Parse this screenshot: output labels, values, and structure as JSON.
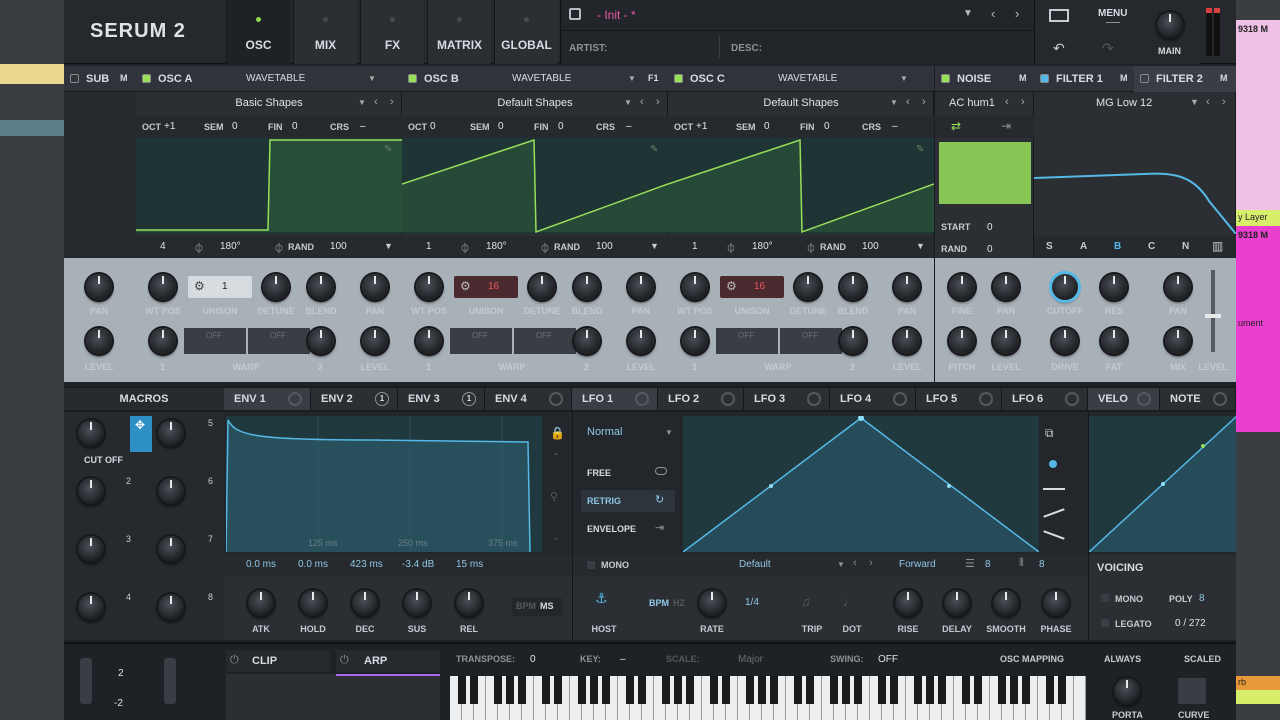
{
  "header": {
    "logo": "SERUM 2",
    "tabs": [
      "OSC",
      "MIX",
      "FX",
      "MATRIX",
      "GLOBAL"
    ],
    "preset_name": "- Init - *",
    "artist_label": "ARTIST:",
    "desc_label": "DESC:",
    "menu_label": "MENU",
    "main_label": "MAIN"
  },
  "host_right": {
    "top_code": "9318 M",
    "layer": "y Layer",
    "mid_code": "9318 M",
    "bottom": "ument",
    "rb": "rb"
  },
  "sub": {
    "label": "SUB",
    "m": "M"
  },
  "osc": [
    {
      "name": "OSC A",
      "type": "WAVETABLE",
      "table": "Basic Shapes",
      "oct": "+1",
      "sem": "0",
      "fin": "0",
      "crs": "–",
      "pos": "4",
      "phase": "180°",
      "rand_label": "RAND",
      "rand": "100",
      "unison": "1",
      "warp_l": "1",
      "warp_r": "2"
    },
    {
      "name": "OSC B",
      "type": "WAVETABLE",
      "table": "Default Shapes",
      "oct": "0",
      "sem": "0",
      "fin": "0",
      "crs": "–",
      "pos": "1",
      "phase": "180°",
      "rand_label": "RAND",
      "rand": "100",
      "unison": "16",
      "warp_l": "1",
      "warp_r": "2",
      "extra": "F1"
    },
    {
      "name": "OSC C",
      "type": "WAVETABLE",
      "table": "Default Shapes",
      "oct": "+1",
      "sem": "0",
      "fin": "0",
      "crs": "–",
      "pos": "1",
      "phase": "180°",
      "rand_label": "RAND",
      "rand": "100",
      "unison": "16",
      "warp_l": "1",
      "warp_r": "2"
    }
  ],
  "osc_labels": {
    "oct": "OCT",
    "sem": "SEM",
    "fin": "FIN",
    "crs": "CRS",
    "pan": "PAN",
    "level": "LEVEL",
    "wtpos": "WT POS",
    "unison": "UNISON",
    "detune": "DETUNE",
    "blend": "BLEND",
    "warp": "WARP",
    "off": "OFF"
  },
  "noise": {
    "label": "NOISE",
    "m": "M",
    "sample": "AC hum1",
    "start_label": "START",
    "start": "0",
    "rand_label": "RAND",
    "rand": "0",
    "fine": "FINE",
    "pan": "PAN",
    "pitch": "PITCH",
    "level": "LEVEL"
  },
  "filter1": {
    "label": "FILTER 1",
    "m": "M",
    "type": "MG Low 12",
    "modes": [
      "S",
      "A",
      "B",
      "C",
      "N"
    ],
    "cutoff": "CUTOFF",
    "res": "RES",
    "drive": "DRIVE",
    "fat": "FAT",
    "pan": "PAN",
    "mix": "MIX",
    "level": "LEVEL"
  },
  "filter2": {
    "label": "FILTER 2",
    "m": "M"
  },
  "mod_tabs": [
    "ENV 1",
    "ENV 2",
    "ENV 3",
    "ENV 4",
    "LFO 1",
    "LFO 2",
    "LFO 3",
    "LFO 4",
    "LFO 5",
    "LFO 6",
    "VELO",
    "NOTE"
  ],
  "mod_badges": {
    "env2": "1",
    "env3": "1"
  },
  "macros": {
    "label": "MACROS",
    "cut_off": "CUT OFF",
    "nums": [
      "5",
      "2",
      "6",
      "3",
      "7",
      "4",
      "8"
    ]
  },
  "env": {
    "grid": [
      "125 ms",
      "250 ms",
      "375 ms"
    ],
    "values": [
      "0.0 ms",
      "0.0 ms",
      "423 ms",
      "-3.4 dB",
      "15 ms"
    ],
    "knobs": [
      "ATK",
      "HOLD",
      "DEC",
      "SUS",
      "REL"
    ],
    "bpm": "BPM",
    "ms": "MS"
  },
  "lfo": {
    "mode": "Normal",
    "trig": [
      "FREE",
      "RETRIG",
      "ENVELOPE"
    ],
    "mono": "MONO",
    "preset": "Default",
    "direction": "Forward",
    "grid_x": "8",
    "grid_y": "8",
    "host": "HOST",
    "bpm": "BPM",
    "hz": "HZ",
    "rate_val": "1/4",
    "knobs": [
      "RATE",
      "TRIP",
      "DOT",
      "RISE",
      "DELAY",
      "SMOOTH",
      "PHASE"
    ]
  },
  "voicing": {
    "label": "VOICING",
    "mono": "MONO",
    "poly": "POLY",
    "poly_val": "8",
    "legato": "LEGATO",
    "count": "0 / 272"
  },
  "bottom": {
    "oct_top": "2",
    "oct_bot": "-2",
    "clip": "CLIP",
    "arp": "ARP",
    "transpose": "TRANSPOSE:",
    "transpose_val": "0",
    "key": "KEY:",
    "key_val": "–",
    "scale": "SCALE:",
    "scale_val": "Major",
    "swing": "SWING:",
    "swing_val": "OFF",
    "osc_mapping": "OSC MAPPING",
    "always": "ALWAYS",
    "scaled": "SCALED",
    "porta": "PORTA",
    "curve": "CURVE"
  }
}
